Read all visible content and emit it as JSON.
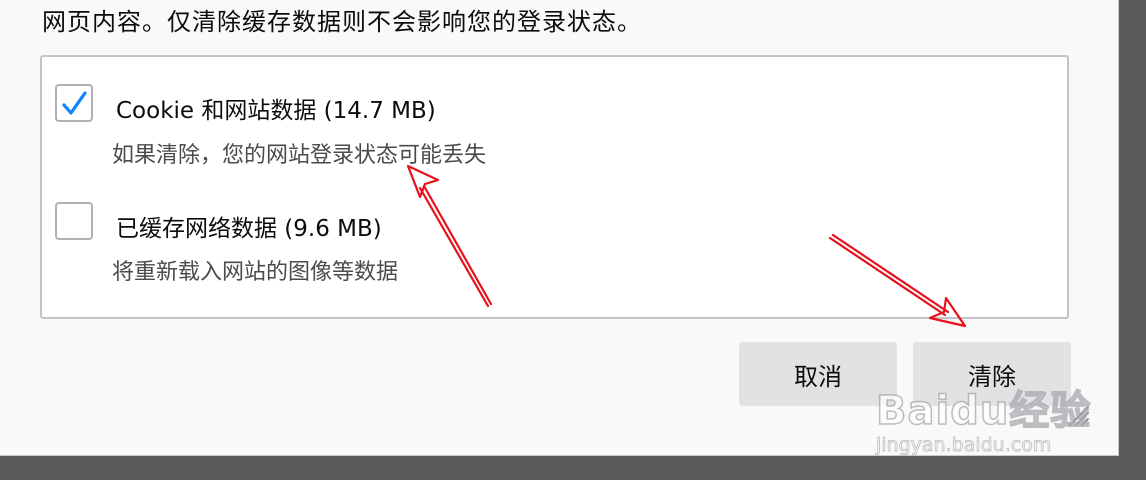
{
  "dialog": {
    "intro_text": "网页内容。仅清除缓存数据则不会影响您的登录状态。"
  },
  "options": [
    {
      "label": "Cookie 和网站数据 (14.7 MB)",
      "description": "如果清除，您的网站登录状态可能丢失",
      "checked": true
    },
    {
      "label": "已缓存网络数据 (9.6 MB)",
      "description": "将重新载入网站的图像等数据",
      "checked": false
    }
  ],
  "buttons": {
    "cancel_label": "取消",
    "clear_label": "清除"
  },
  "icons": {
    "checkmark": "checkmark-icon",
    "resize": "resize-grip-icon"
  },
  "colors": {
    "checkmark": "#0a84ff",
    "annotation_arrow": "#e8101b",
    "button_bg": "#e2e2e4"
  },
  "watermark": {
    "logo": "Baidu经验",
    "url": "jingyan.baidu.com"
  }
}
